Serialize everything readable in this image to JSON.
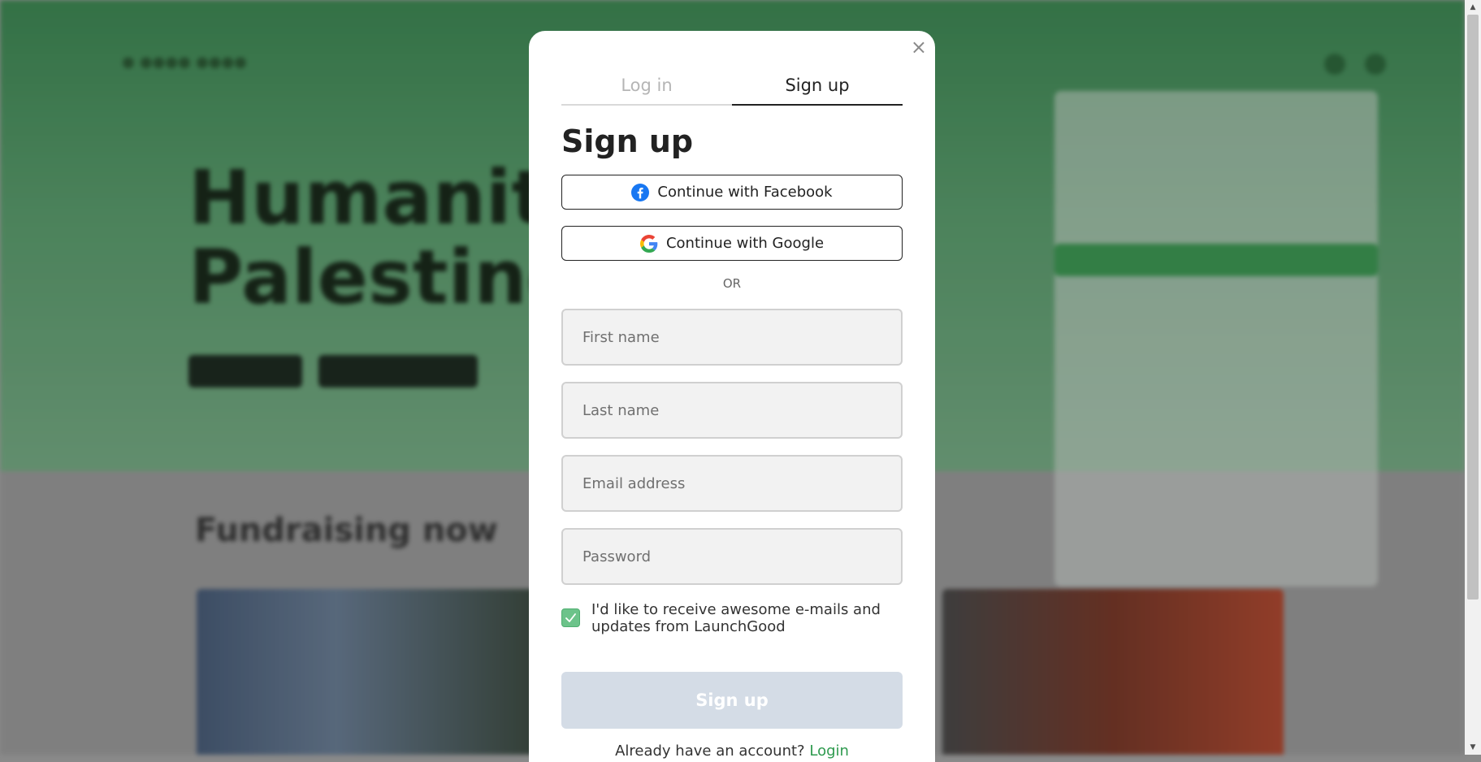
{
  "modal": {
    "close_glyph": "×",
    "tabs": [
      {
        "label": "Log in",
        "active": false
      },
      {
        "label": "Sign up",
        "active": true
      }
    ],
    "title": "Sign up",
    "facebook_label": "Continue with Facebook",
    "google_label": "Continue with Google",
    "divider": "OR",
    "fields": {
      "first_name": {
        "placeholder": "First name",
        "value": ""
      },
      "last_name": {
        "placeholder": "Last name",
        "value": ""
      },
      "email": {
        "placeholder": "Email address",
        "value": ""
      },
      "password": {
        "placeholder": "Password",
        "value": ""
      }
    },
    "newsletter": {
      "checked": true,
      "label": "I'd like to receive awesome e-mails and updates from LaunchGood"
    },
    "submit_label": "Sign up",
    "footer_text": "Already have an account?",
    "login_link": "Login"
  },
  "background": {
    "hero_title_line1": "Humanitar",
    "hero_title_line2": "Palestine",
    "section_heading": "Fundraising now"
  },
  "colors": {
    "accent_green": "#2e9a4e",
    "checkbox_green": "#6cc38a",
    "submit_disabled": "#d4dce6",
    "facebook_blue": "#1877f2"
  },
  "icons": [
    "close-icon",
    "facebook-icon",
    "google-icon",
    "checkmark-icon"
  ]
}
